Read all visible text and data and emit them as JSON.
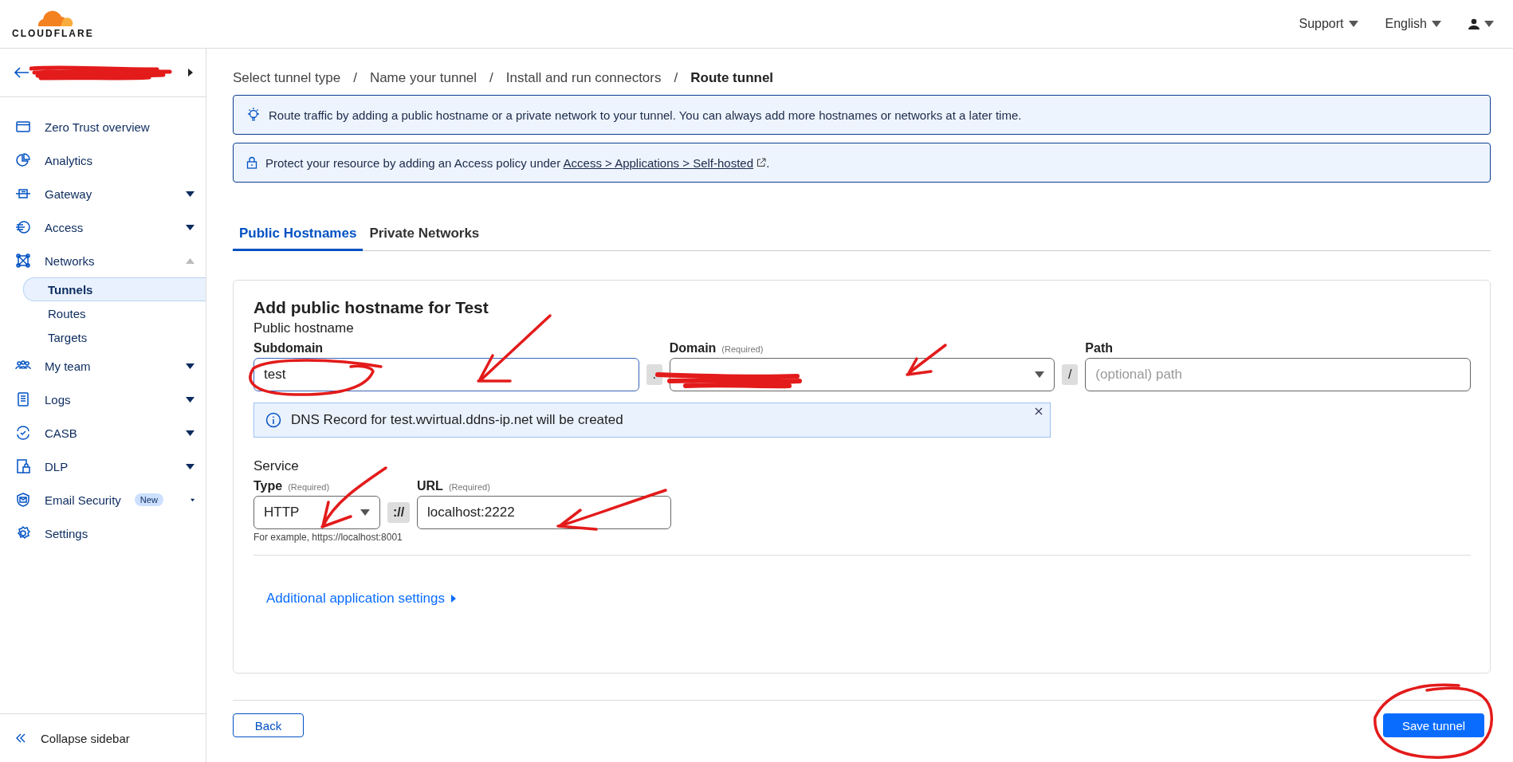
{
  "header": {
    "logo_text": "CLOUDFLARE",
    "menus": [
      {
        "label": "Support"
      },
      {
        "label": "English"
      }
    ]
  },
  "sidebar": {
    "items": [
      {
        "label": "Zero Trust overview",
        "kind": "link"
      },
      {
        "label": "Analytics",
        "kind": "link"
      },
      {
        "label": "Gateway",
        "kind": "group",
        "expanded": false
      },
      {
        "label": "Access",
        "kind": "group",
        "expanded": false
      },
      {
        "label": "Networks",
        "kind": "group",
        "expanded": true,
        "children": [
          {
            "label": "Tunnels",
            "selected": true
          },
          {
            "label": "Routes",
            "selected": false
          },
          {
            "label": "Targets",
            "selected": false
          }
        ]
      },
      {
        "label": "My team",
        "kind": "group",
        "expanded": false
      },
      {
        "label": "Logs",
        "kind": "group",
        "expanded": false
      },
      {
        "label": "CASB",
        "kind": "group",
        "expanded": false
      },
      {
        "label": "DLP",
        "kind": "group",
        "expanded": false
      },
      {
        "label": "Email Security",
        "kind": "group",
        "expanded": false,
        "badge": "New"
      },
      {
        "label": "Settings",
        "kind": "link"
      }
    ],
    "collapse": "Collapse sidebar"
  },
  "breadcrumb": [
    {
      "label": "Select tunnel type",
      "current": false
    },
    {
      "label": "Name your tunnel",
      "current": false
    },
    {
      "label": "Install and run connectors",
      "current": false
    },
    {
      "label": "Route tunnel",
      "current": true
    }
  ],
  "breadcrumb_separator": "/",
  "banners": [
    {
      "text": "Route traffic by adding a public hostname or a private network to your tunnel. You can always add more hostnames or networks at a later time."
    },
    {
      "text": "Protect your resource by adding an Access policy under ",
      "link": "Access > Applications > Self-hosted",
      "text_after": "."
    }
  ],
  "tabs": [
    {
      "label": "Public Hostnames",
      "selected": true
    },
    {
      "label": "Private Networks",
      "selected": false
    }
  ],
  "card": {
    "title": "Add public hostname for Test",
    "section": "Public hostname",
    "subdomain": {
      "label": "Subdomain",
      "value": "test"
    },
    "dot": ".",
    "domain": {
      "label": "Domain",
      "note": "(Required)"
    },
    "slash": "/",
    "path": {
      "label": "Path",
      "placeholder": "(optional) path"
    },
    "dns_notice": "DNS Record for test.wvirtual.ddns-ip.net will be created",
    "service": "Service",
    "type": {
      "label": "Type",
      "note": "(Required)",
      "value": "HTTP"
    },
    "scheme": "://",
    "url": {
      "label": "URL",
      "note": "(Required)",
      "value": "localhost:2222"
    },
    "hint": "For example, https://localhost:8001",
    "more": "Additional application settings"
  },
  "buttons": {
    "back": "Back",
    "save": "Save tunnel"
  }
}
